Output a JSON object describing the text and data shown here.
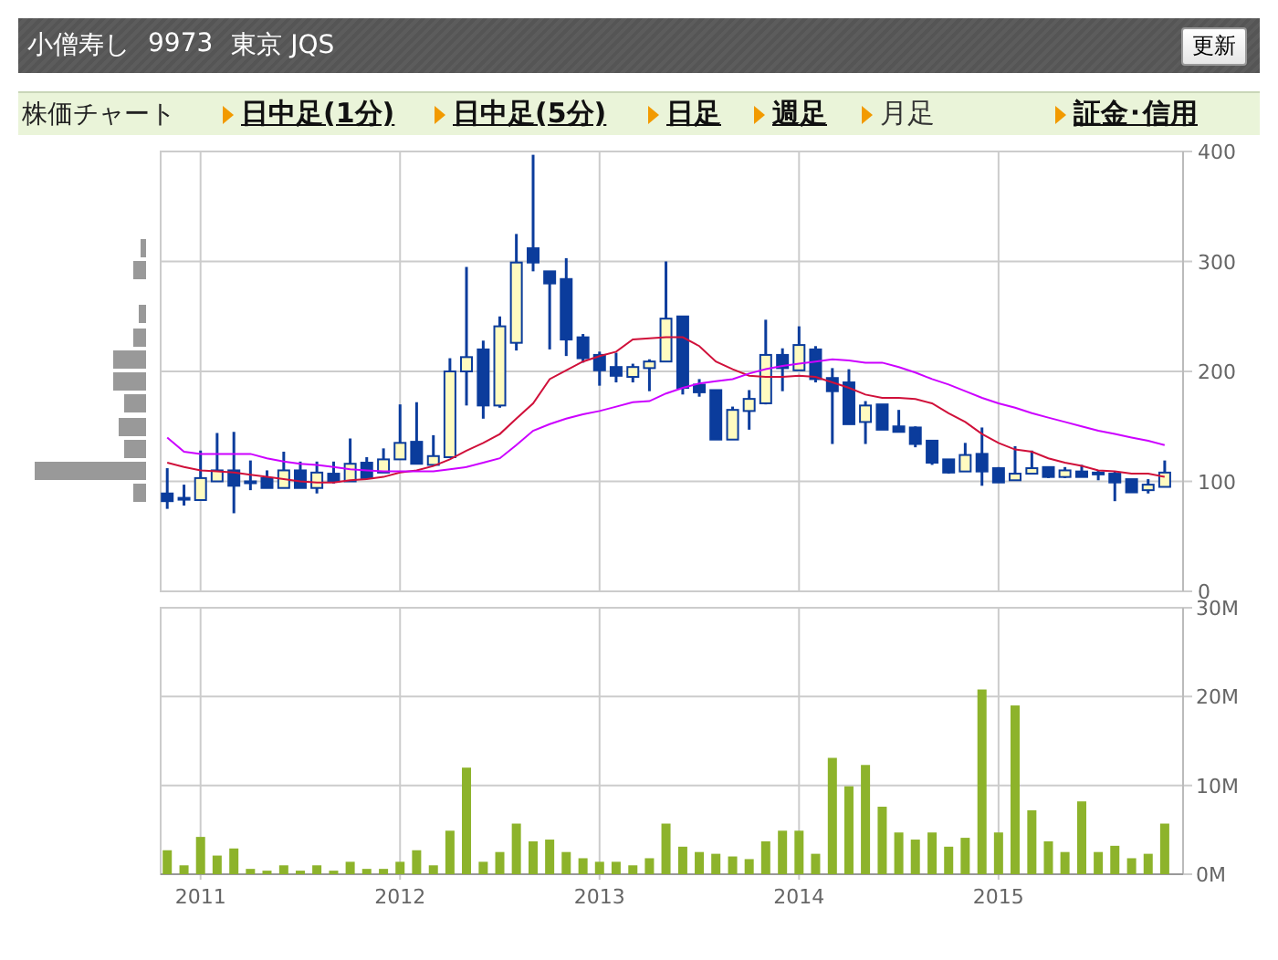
{
  "header": {
    "company": "小僧寿し",
    "code": "9973",
    "market": "東京 JQS",
    "refresh_button": "更新"
  },
  "chart_menu": {
    "label": "株価チャート",
    "tabs": [
      {
        "label": "日中足(1分)",
        "selected": false
      },
      {
        "label": "日中足(5分)",
        "selected": false
      },
      {
        "label": "日足",
        "selected": false
      },
      {
        "label": "週足",
        "selected": false
      },
      {
        "label": "月足",
        "selected": true
      },
      {
        "label": "証金･信用",
        "selected": false
      }
    ]
  },
  "price_chart": {
    "chart_data": {
      "type": "candlestick",
      "grid": true,
      "xlim": [
        2010.8,
        2015.925
      ],
      "ylim": [
        0,
        400
      ],
      "yticks": [
        {
          "value": 0,
          "label": "0"
        },
        {
          "value": 100,
          "label": "100"
        },
        {
          "value": 200,
          "label": "200"
        },
        {
          "value": 300,
          "label": "300"
        },
        {
          "value": 400,
          "label": "400"
        }
      ],
      "x": [
        2010.833,
        2010.917,
        2011,
        2011.083,
        2011.167,
        2011.25,
        2011.333,
        2011.417,
        2011.5,
        2011.583,
        2011.667,
        2011.75,
        2011.833,
        2011.917,
        2012,
        2012.083,
        2012.167,
        2012.25,
        2012.333,
        2012.417,
        2012.5,
        2012.583,
        2012.667,
        2012.75,
        2012.833,
        2012.917,
        2013,
        2013.083,
        2013.167,
        2013.25,
        2013.333,
        2013.417,
        2013.5,
        2013.583,
        2013.667,
        2013.75,
        2013.833,
        2013.917,
        2014,
        2014.083,
        2014.167,
        2014.25,
        2014.333,
        2014.417,
        2014.5,
        2014.583,
        2014.667,
        2014.75,
        2014.833,
        2014.917,
        2015,
        2015.083,
        2015.167,
        2015.25,
        2015.333,
        2015.417,
        2015.5,
        2015.583,
        2015.667,
        2015.75,
        2015.833
      ],
      "ohlc": [
        [
          89,
          112,
          75,
          82
        ],
        [
          85,
          97,
          78,
          85
        ],
        [
          83,
          128,
          83,
          103
        ],
        [
          100,
          144,
          100,
          110
        ],
        [
          110,
          145,
          71,
          96
        ],
        [
          100,
          119,
          92,
          99
        ],
        [
          103,
          110,
          94,
          94
        ],
        [
          94,
          127,
          94,
          110
        ],
        [
          110,
          118,
          94,
          94
        ],
        [
          94,
          118,
          89,
          108
        ],
        [
          107,
          118,
          98,
          100
        ],
        [
          100,
          139,
          100,
          116
        ],
        [
          117,
          122,
          103,
          103
        ],
        [
          108,
          130,
          108,
          120
        ],
        [
          120,
          170,
          120,
          135
        ],
        [
          136,
          172,
          116,
          116
        ],
        [
          115,
          142,
          115,
          123
        ],
        [
          122,
          212,
          122,
          200
        ],
        [
          200,
          295,
          169,
          213
        ],
        [
          220,
          228,
          157,
          169
        ],
        [
          169,
          250,
          167,
          241
        ],
        [
          226,
          325,
          219,
          299
        ],
        [
          312,
          397,
          291,
          299
        ],
        [
          291,
          291,
          220,
          280
        ],
        [
          284,
          303,
          214,
          229
        ],
        [
          231,
          234,
          208,
          212
        ],
        [
          215,
          218,
          187,
          201
        ],
        [
          204,
          217,
          190,
          196
        ],
        [
          195,
          207,
          190,
          204
        ],
        [
          203,
          211,
          182,
          209
        ],
        [
          209,
          300,
          209,
          248
        ],
        [
          250,
          250,
          179,
          185
        ],
        [
          188,
          193,
          177,
          181
        ],
        [
          183,
          183,
          138,
          138
        ],
        [
          138,
          168,
          138,
          165
        ],
        [
          164,
          183,
          147,
          175
        ],
        [
          171,
          247,
          170,
          215
        ],
        [
          215,
          221,
          182,
          203
        ],
        [
          201,
          241,
          201,
          224
        ],
        [
          220,
          223,
          190,
          193
        ],
        [
          194,
          203,
          134,
          182
        ],
        [
          190,
          202,
          152,
          152
        ],
        [
          154,
          173,
          134,
          169
        ],
        [
          170,
          170,
          147,
          147
        ],
        [
          150,
          165,
          145,
          145
        ],
        [
          149,
          150,
          131,
          134
        ],
        [
          137,
          137,
          115,
          117
        ],
        [
          120,
          120,
          107,
          108
        ],
        [
          109,
          135,
          109,
          124
        ],
        [
          125,
          149,
          96,
          109
        ],
        [
          112,
          113,
          99,
          99
        ],
        [
          101,
          132,
          101,
          107
        ],
        [
          107,
          128,
          107,
          112
        ],
        [
          113,
          113,
          103,
          104
        ],
        [
          104,
          113,
          103,
          110
        ],
        [
          109,
          115,
          104,
          104
        ],
        [
          108,
          110,
          101,
          107
        ],
        [
          107,
          109,
          82,
          99
        ],
        [
          102,
          102,
          90,
          90
        ],
        [
          92,
          102,
          89,
          97
        ],
        [
          95,
          119,
          95,
          108
        ]
      ],
      "series": [
        {
          "type": "line",
          "color": "#d0103a",
          "values": [
            117,
            113,
            110,
            109,
            108,
            106,
            104,
            102,
            100,
            99,
            99,
            101,
            102,
            104,
            108,
            110,
            114,
            120,
            128,
            135,
            143,
            157,
            171,
            193,
            201,
            209,
            214,
            218,
            229,
            230,
            231,
            231,
            223,
            209,
            202,
            196,
            195,
            195,
            196,
            195,
            190,
            185,
            179,
            176,
            176,
            175,
            171,
            162,
            154,
            143,
            135,
            129,
            127,
            121,
            117,
            114,
            110,
            109,
            107,
            107,
            104
          ]
        },
        {
          "type": "line",
          "color": "#cc00ff",
          "values": [
            140,
            127,
            125,
            125,
            125,
            125,
            121,
            118,
            116,
            115,
            113,
            111,
            110,
            109,
            109,
            109,
            109,
            111,
            113,
            117,
            121,
            133,
            146,
            152,
            157,
            161,
            164,
            168,
            172,
            173,
            180,
            185,
            189,
            191,
            193,
            198,
            202,
            205,
            207,
            209,
            211,
            210,
            208,
            208,
            204,
            199,
            193,
            188,
            182,
            176,
            171,
            167,
            162,
            158,
            154,
            150,
            146,
            143,
            140,
            137,
            133
          ]
        }
      ]
    }
  },
  "volume_chart": {
    "chart_data": {
      "type": "bar",
      "grid": true,
      "ylim": [
        0,
        30
      ],
      "yticks": [
        {
          "value": 0,
          "label": "0M"
        },
        {
          "value": 10,
          "label": "10M"
        },
        {
          "value": 20,
          "label": "20M"
        },
        {
          "value": 30,
          "label": "30M"
        }
      ],
      "xlim": [
        2010.8,
        2015.925
      ],
      "xticks": [
        2011,
        2012,
        2013,
        2014,
        2015
      ],
      "x": [
        2010.833,
        2010.917,
        2011,
        2011.083,
        2011.167,
        2011.25,
        2011.333,
        2011.417,
        2011.5,
        2011.583,
        2011.667,
        2011.75,
        2011.833,
        2011.917,
        2012,
        2012.083,
        2012.167,
        2012.25,
        2012.333,
        2012.417,
        2012.5,
        2012.583,
        2012.667,
        2012.75,
        2012.833,
        2012.917,
        2013,
        2013.083,
        2013.167,
        2013.25,
        2013.333,
        2013.417,
        2013.5,
        2013.583,
        2013.667,
        2013.75,
        2013.833,
        2013.917,
        2014,
        2014.083,
        2014.167,
        2014.25,
        2014.333,
        2014.417,
        2014.5,
        2014.583,
        2014.667,
        2014.75,
        2014.833,
        2014.917,
        2015,
        2015.083,
        2015.167,
        2015.25,
        2015.333,
        2015.417,
        2015.5,
        2015.583,
        2015.667,
        2015.75,
        2015.833
      ],
      "series": [
        {
          "color": "#8db32b",
          "values": [
            2.7,
            1,
            4.2,
            2.1,
            2.9,
            0.6,
            0.4,
            1,
            0.4,
            1,
            0.4,
            1.4,
            0.6,
            0.6,
            1.4,
            2.7,
            1,
            4.9,
            12,
            1.4,
            2.5,
            5.7,
            3.7,
            3.9,
            2.5,
            1.8,
            1.4,
            1.4,
            1,
            1.8,
            5.7,
            3.1,
            2.5,
            2.3,
            2,
            1.7,
            3.7,
            4.9,
            4.9,
            2.3,
            13.1,
            9.9,
            12.3,
            7.6,
            4.7,
            3.9,
            4.7,
            3.1,
            4.1,
            20.8,
            4.7,
            19,
            7.2,
            3.7,
            2.5,
            8.2,
            2.5,
            3.2,
            1.8,
            2.3,
            5.7
          ]
        }
      ]
    }
  }
}
